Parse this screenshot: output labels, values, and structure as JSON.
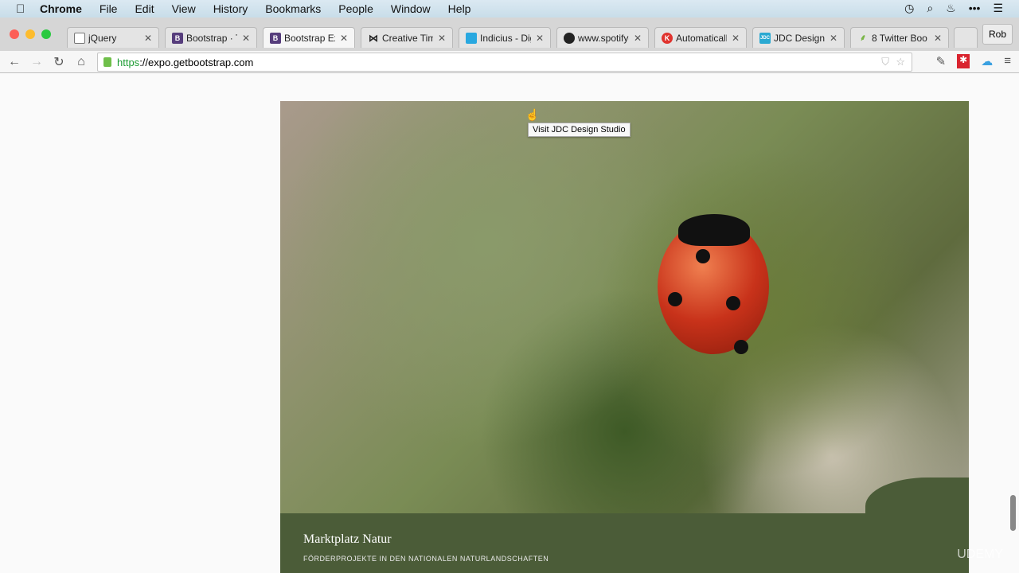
{
  "menubar": {
    "app": "Chrome",
    "items": [
      "File",
      "Edit",
      "View",
      "History",
      "Bookmarks",
      "People",
      "Window",
      "Help"
    ]
  },
  "tabs": [
    {
      "title": "jQuery",
      "favicon": "page-icon",
      "color": "#ffffff"
    },
    {
      "title": "Bootstrap · Th",
      "favicon": "B",
      "color": "#563d7c"
    },
    {
      "title": "Bootstrap Exp",
      "favicon": "B",
      "color": "#563d7c",
      "active": true
    },
    {
      "title": "Creative Tim",
      "favicon": "bowtie-icon",
      "color": "#222222"
    },
    {
      "title": "Indicius - Dig",
      "favicon": "I",
      "color": "#29a8e0"
    },
    {
      "title": "www.spotify-",
      "favicon": "spotify-icon",
      "color": "#222222"
    },
    {
      "title": "Automatically",
      "favicon": "K",
      "color": "#e0332e"
    },
    {
      "title": "JDC Design S",
      "favicon": "JDC",
      "color": "#2aa9d2"
    },
    {
      "title": "8 Twitter Boo",
      "favicon": "leaf-icon",
      "color": "#7ab648"
    }
  ],
  "profile": "Rob",
  "url": {
    "scheme": "https",
    "rest": "://expo.getbootstrap.com"
  },
  "tooltip": "Visit JDC Design Studio",
  "showcase": {
    "title": "Marktplatz Natur",
    "subtitle": "FÖRDERPROJEKTE IN DEN NATIONALEN NATURLANDSCHAFTEN"
  },
  "watermark": "UDEMY"
}
